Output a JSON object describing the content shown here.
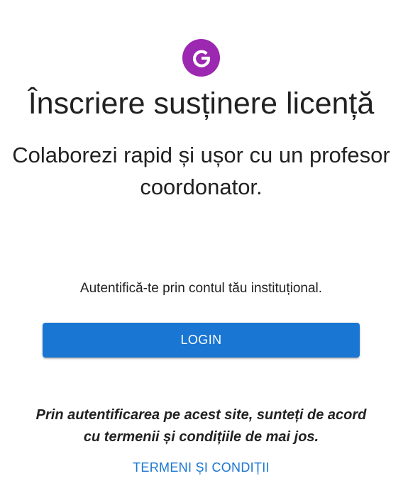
{
  "brand": {
    "logo_icon": "google-g-icon",
    "logo_color": "#9c27b0"
  },
  "header": {
    "title": "Înscriere susținere licență",
    "subtitle": "Colaborezi rapid și ușor cu un profesor coordonator."
  },
  "auth": {
    "hint": "Autentifică-te prin contul tău instituțional.",
    "login_label": "LOGIN",
    "button_color": "#1976d2"
  },
  "footer": {
    "notice": "Prin autentificarea pe acest site, sunteți de acord cu termenii și condițiile de mai jos.",
    "terms_link": "TERMENI ȘI CONDIȚII",
    "link_color": "#1976d2"
  }
}
